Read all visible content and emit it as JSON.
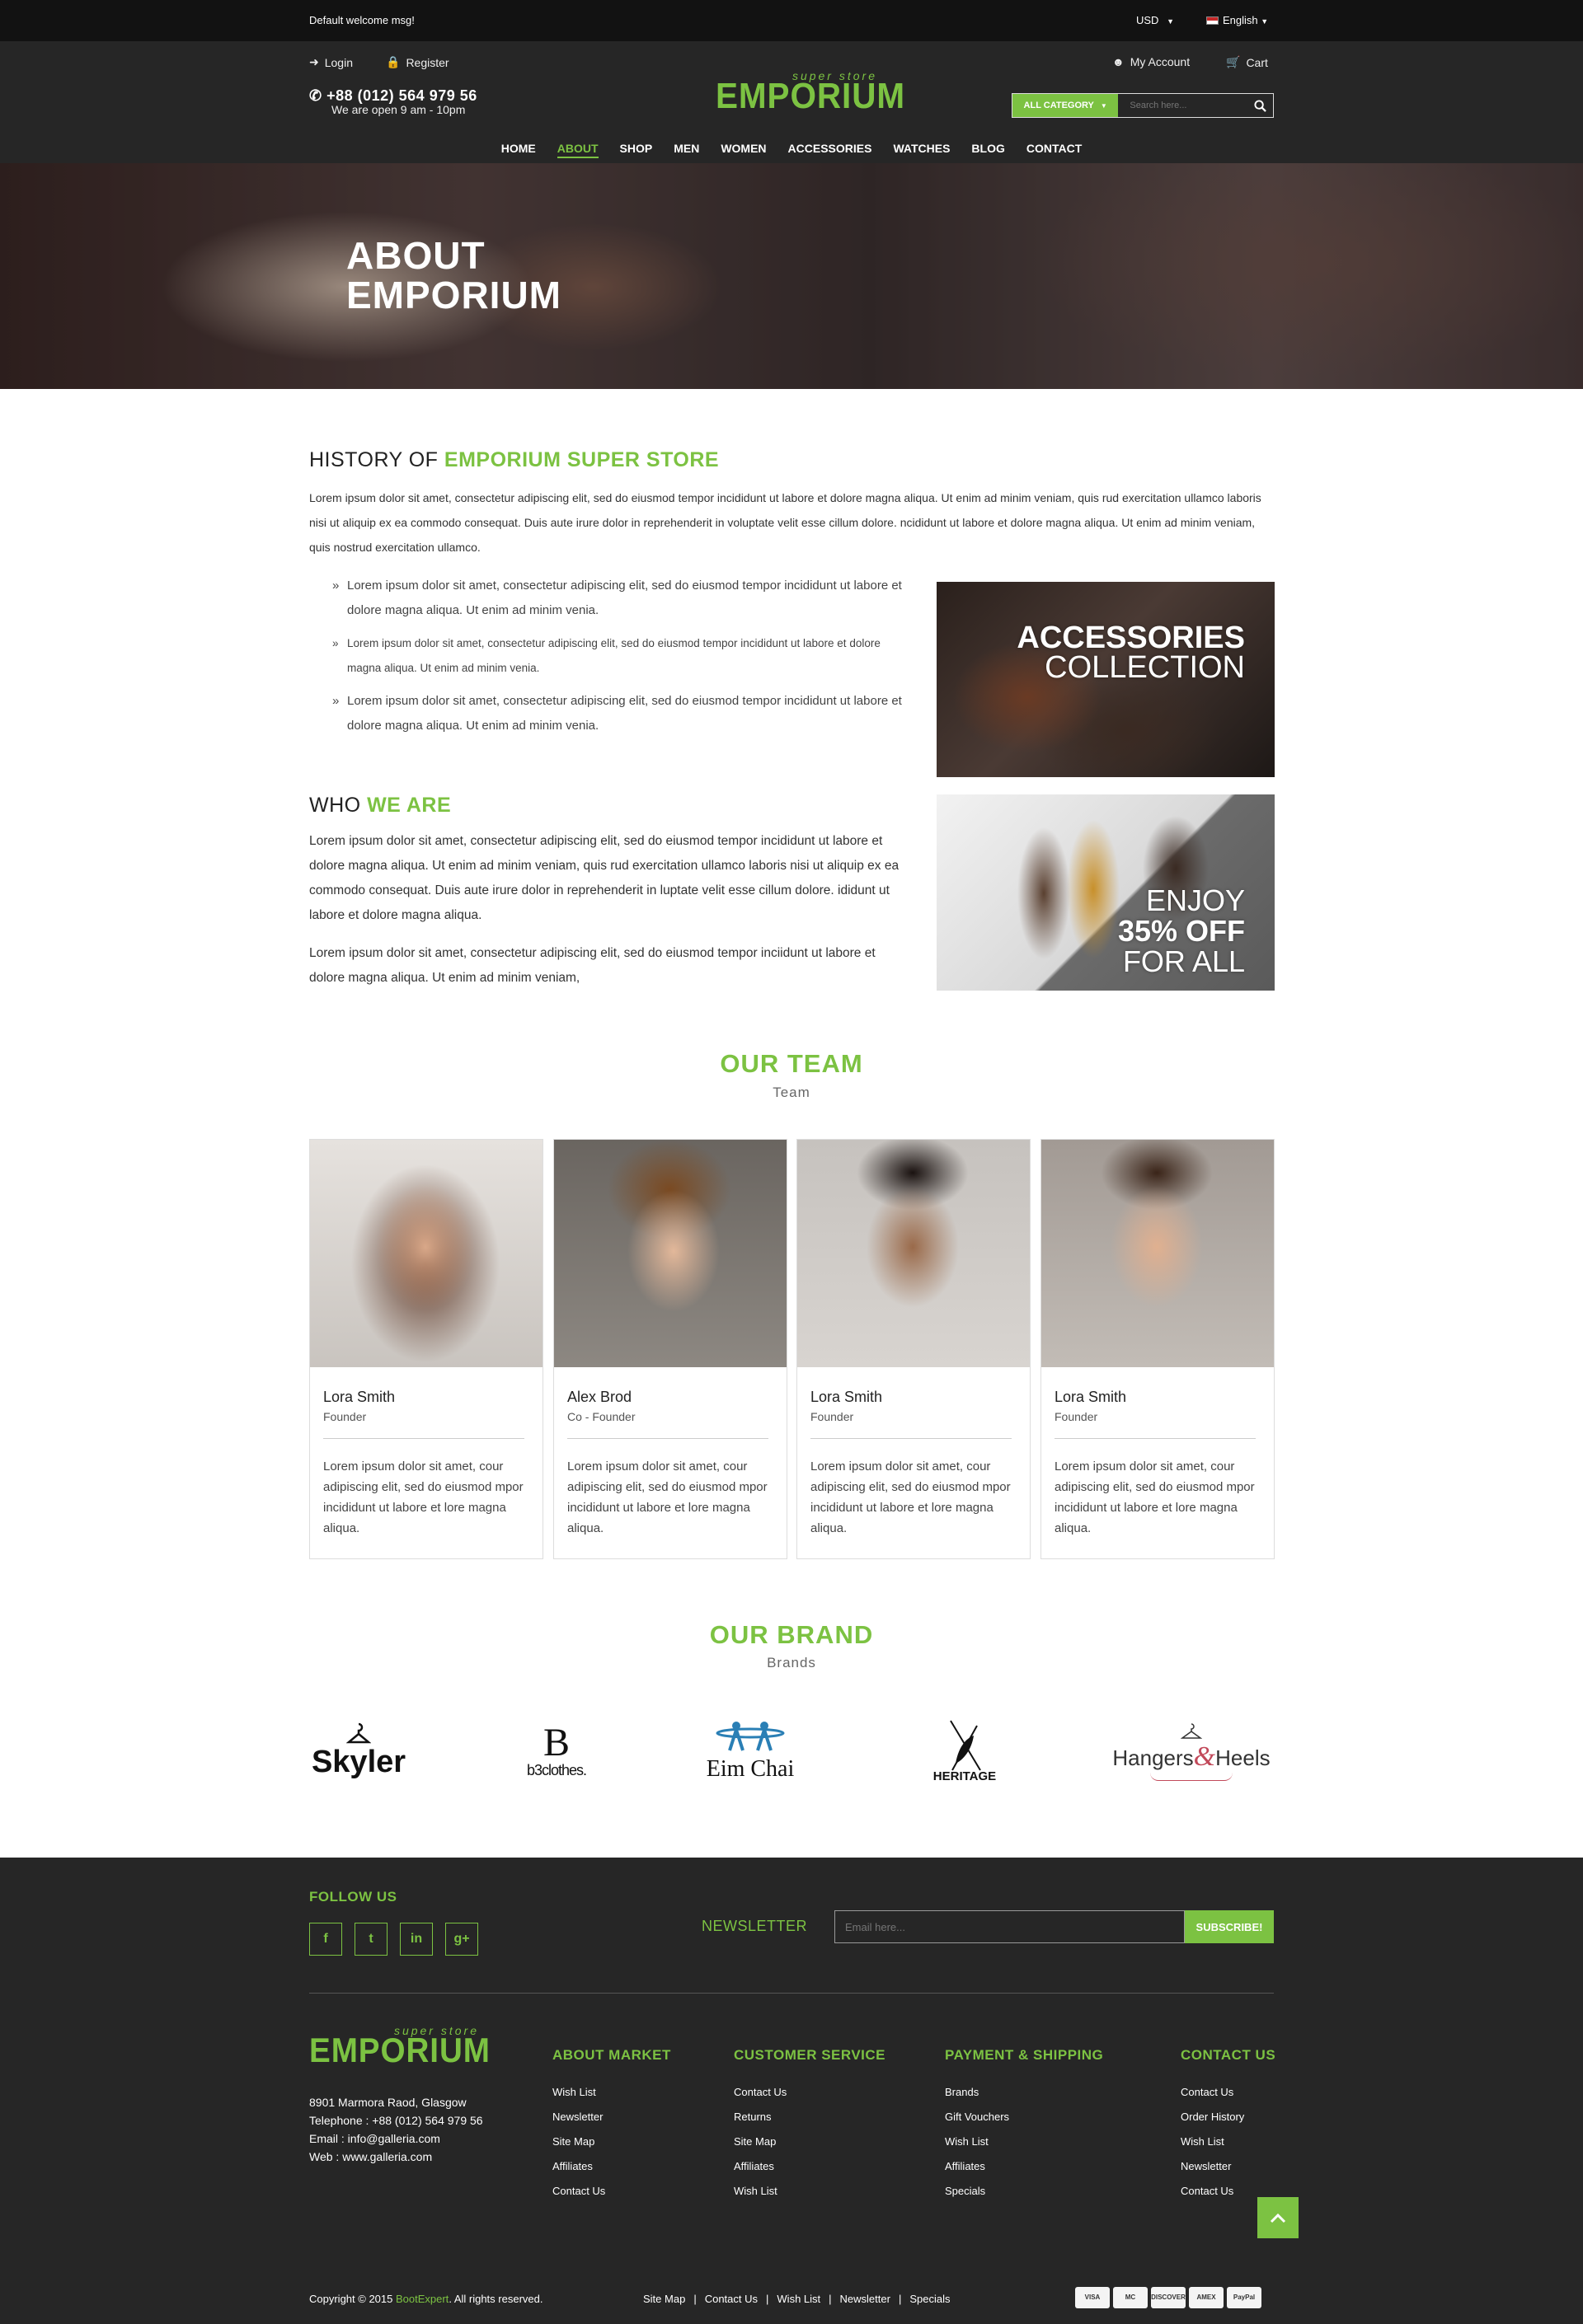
{
  "topbar": {
    "welcome": "Default welcome msg!",
    "currency": "USD",
    "language": "English"
  },
  "header": {
    "login": "Login",
    "register": "Register",
    "phone": "+88 (012) 564 979 56",
    "hours": "We are open 9 am - 10pm",
    "logo_sub": "super store",
    "logo_main": "EMPORIUM",
    "my_account": "My Account",
    "cart": "Cart",
    "search_category": "ALL CATEGORY",
    "search_placeholder": "Search here..."
  },
  "nav": [
    "HOME",
    "ABOUT",
    "SHOP",
    "MEN",
    "WOMEN",
    "ACCESSORIES",
    "WATCHES",
    "BLOG",
    "CONTACT"
  ],
  "nav_active": "ABOUT",
  "hero": {
    "line1": "ABOUT",
    "line2": "EMPORIUM"
  },
  "history": {
    "title_plain": "HISTORY OF",
    "title_accent": "EMPORIUM SUPER STORE",
    "paragraph": "Lorem ipsum dolor sit amet, consectetur adipiscing elit, sed do eiusmod tempor incididunt ut labore et dolore magna aliqua. Ut enim ad minim veniam, quis  rud exercitation ullamco laboris nisi ut aliquip ex ea commodo consequat. Duis aute irure dolor in reprehenderit in voluptate velit esse cillum dolore. ncididunt ut labore et dolore magna aliqua. Ut enim ad minim veniam, quis nostrud exercitation ullamco.",
    "bullets": [
      "Lorem ipsum dolor sit amet, consectetur adipiscing elit, sed do eiusmod tempor incididunt ut labore et dolore magna aliqua. Ut enim ad minim venia.",
      "Lorem ipsum dolor sit amet, consectetur adipiscing elit, sed do eiusmod tempor incididunt ut labore et dolore magna aliqua. Ut enim ad minim venia.",
      "Lorem ipsum dolor sit amet, consectetur adipiscing elit, sed do eiusmod tempor incididunt ut labore et dolore magna aliqua. Ut enim ad minim venia."
    ]
  },
  "promo1": {
    "line1": "ACCESSORIES",
    "line2": "COLLECTION"
  },
  "promo2": {
    "line1": "ENJOY",
    "line2": "35% OFF",
    "line3": "FOR ALL"
  },
  "who": {
    "title_plain": "WHO",
    "title_accent": "WE ARE",
    "p1": "Lorem ipsum dolor sit amet, consectetur adipiscing elit, sed do eiusmod tempor incididunt ut labore et dolore magna aliqua. Ut enim ad minim veniam, quis  rud exercitation ullamco laboris nisi ut aliquip ex ea commodo consequat. Duis aute irure dolor in reprehenderit in luptate velit esse cillum dolore. ididunt ut labore et dolore magna aliqua.",
    "p2": "Lorem ipsum dolor sit amet, consectetur adipiscing elit, sed do eiusmod tempor inciidunt ut labore et dolore magna aliqua. Ut enim ad minim veniam,"
  },
  "team": {
    "title": "OUR TEAM",
    "subtitle": "Team",
    "members": [
      {
        "name": "Lora Smith",
        "role": "Founder",
        "bio": "Lorem ipsum dolor sit amet, cour adipiscing elit, sed do eiusmod mpor incididunt ut labore et lore magna aliqua."
      },
      {
        "name": "Alex Brod",
        "role": "Co - Founder",
        "bio": "Lorem ipsum dolor sit amet, cour adipiscing elit, sed do eiusmod mpor incididunt ut labore et lore magna aliqua."
      },
      {
        "name": "Lora Smith",
        "role": "Founder",
        "bio": "Lorem ipsum dolor sit amet, cour adipiscing elit, sed do eiusmod mpor incididunt ut labore et lore magna aliqua."
      },
      {
        "name": "Lora Smith",
        "role": "Founder",
        "bio": "Lorem ipsum dolor sit amet, cour adipiscing elit, sed do eiusmod mpor incididunt ut labore et lore magna aliqua."
      }
    ]
  },
  "brands": {
    "title": "OUR BRAND",
    "subtitle": "Brands",
    "names": [
      "Skyler",
      "b3clothes.",
      "Eim Chai",
      "HERITAGE",
      "Hangers",
      "&",
      "Heels"
    ]
  },
  "footer": {
    "follow": "FOLLOW US",
    "social": [
      "f",
      "t",
      "in",
      "g+"
    ],
    "newsletter_label": "NEWSLETTER",
    "email_placeholder": "Email here...",
    "subscribe": "SUBSCRIBE!",
    "logo_sub": "super store",
    "logo_main": "EMPORIUM",
    "address": [
      "8901 Marmora Raod, Glasgow",
      "Telephone : +88 (012) 564 979 56",
      "Email : info@galleria.com",
      "Web : www.galleria.com"
    ],
    "columns": [
      {
        "title": "ABOUT MARKET",
        "items": [
          "Wish List",
          "Newsletter",
          "Site Map",
          "Affiliates",
          "Contact Us"
        ]
      },
      {
        "title": "CUSTOMER SERVICE",
        "items": [
          "Contact Us",
          "Returns",
          "Site Map",
          "Affiliates",
          "Wish List"
        ]
      },
      {
        "title": "PAYMENT & SHIPPING",
        "items": [
          "Brands",
          "Gift Vouchers",
          "Wish List",
          "Affiliates",
          "Specials"
        ]
      },
      {
        "title": "CONTACT US",
        "items": [
          "Contact Us",
          "Order History",
          "Wish List",
          "Newsletter",
          "Contact Us"
        ]
      }
    ],
    "copyright_pre": "Copyright © 2015",
    "copyright_brand": "BootExpert",
    "copyright_post": ". All rights reserved.",
    "bottom_links": [
      "Site Map",
      "Contact Us",
      "Wish List",
      "Newsletter",
      "Specials"
    ],
    "payments": [
      "VISA",
      "MC",
      "DISCOVER",
      "AMEX",
      "PayPal"
    ]
  },
  "colors": {
    "accent": "#7cc242",
    "dark": "#262626",
    "topbar": "#121212"
  }
}
